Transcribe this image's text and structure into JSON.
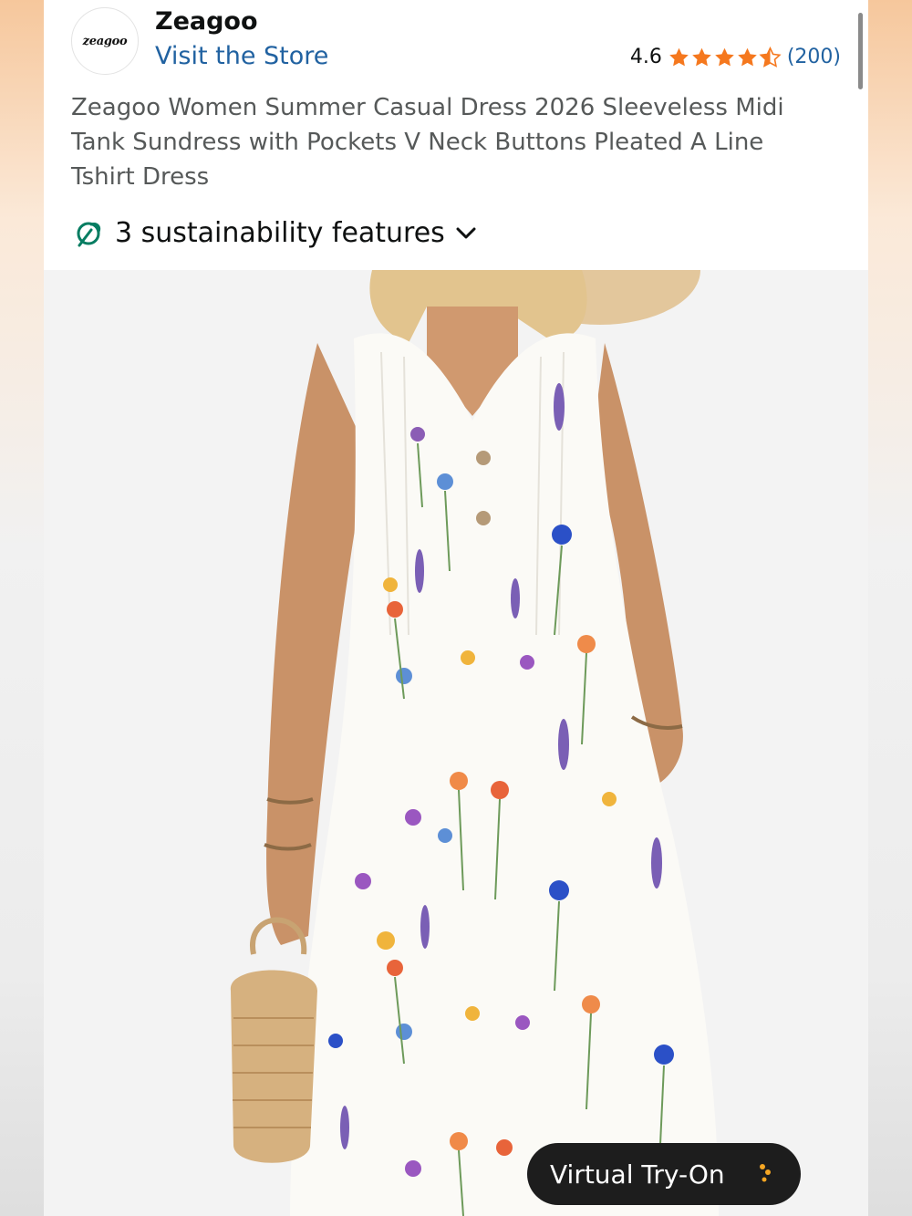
{
  "store": {
    "logo_text": "zeagoo",
    "brand_name": "Zeagoo",
    "visit_link": "Visit the Store"
  },
  "rating": {
    "value": "4.6",
    "stars": 4.6,
    "max_stars": 5,
    "count": "(200)",
    "star_color": "#f5781e"
  },
  "product": {
    "title_lines": [
      "Zeagoo Women Summer Casual Dress 2026 Sleeveless Midi",
      "Tank Sundress with Pockets V Neck Buttons Pleated A Line",
      "Tshirt Dress"
    ]
  },
  "sustainability": {
    "label": "3 sustainability features",
    "icon": "leaf-icon",
    "icon_color": "#067d62"
  },
  "image": {
    "icon": "product-photo-floral-dress"
  },
  "virtual_try_on": {
    "label": "Virtual Try-On",
    "icon": "sparkle-icon"
  },
  "colors": {
    "link": "#2162a1",
    "title_text": "#565959"
  }
}
